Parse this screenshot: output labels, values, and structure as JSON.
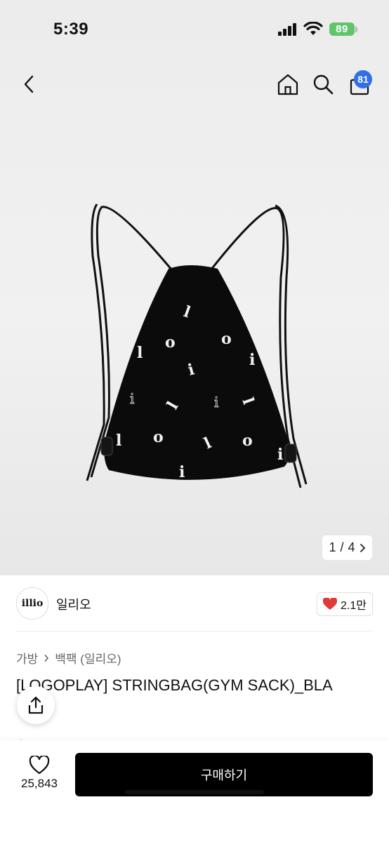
{
  "status_bar": {
    "time": "5:39",
    "battery": "89"
  },
  "nav": {
    "cart_badge": "81"
  },
  "gallery": {
    "current": "1",
    "separator": "/",
    "total": "4"
  },
  "brand": {
    "logo_text": "illio",
    "name": "일리오",
    "likes": "2.1만"
  },
  "breadcrumb": {
    "items": [
      "가방",
      "백팩 (일리오)"
    ]
  },
  "product": {
    "title": "[LOGOPLAY] STRINGBAG(GYM SACK)_BLA"
  },
  "bottom_bar": {
    "wish_count": "25,843",
    "buy_label": "구매하기"
  },
  "colors": {
    "buy_button": "#000000",
    "badge": "#2f6fe8",
    "battery": "#5fc46b",
    "heart": "#e03a3a"
  }
}
